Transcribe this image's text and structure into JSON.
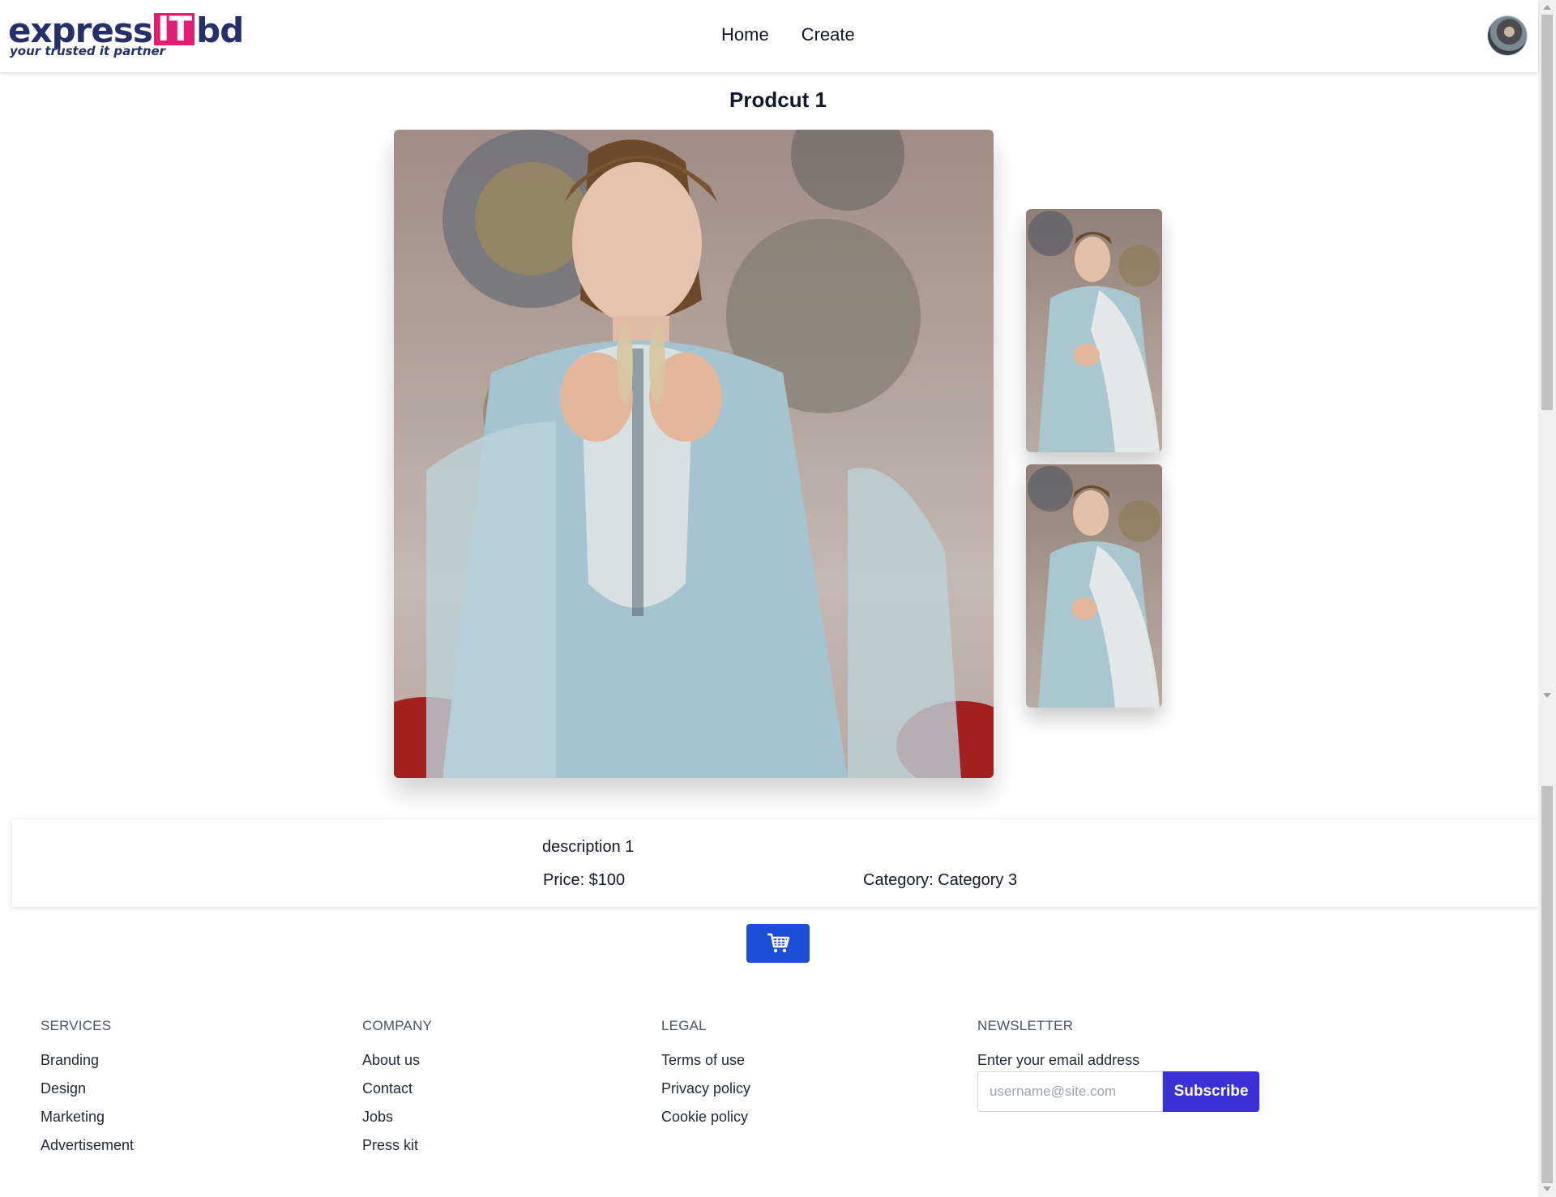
{
  "header": {
    "logo": {
      "brand_left": "express",
      "brand_highlight": "IT",
      "brand_right": "bd",
      "tagline": "your trusted it partner"
    },
    "nav": [
      {
        "label": "Home"
      },
      {
        "label": "Create"
      }
    ],
    "avatar_icon": "user-avatar"
  },
  "product": {
    "title": "Prodcut 1",
    "description": "description 1",
    "price_text": "Price: $100",
    "category_text": "Category: Category 3",
    "cart_icon": "shopping-cart-icon"
  },
  "footer": {
    "services": {
      "heading": "SERVICES",
      "links": [
        "Branding",
        "Design",
        "Marketing",
        "Advertisement"
      ]
    },
    "company": {
      "heading": "COMPANY",
      "links": [
        "About us",
        "Contact",
        "Jobs",
        "Press kit"
      ]
    },
    "legal": {
      "heading": "LEGAL",
      "links": [
        "Terms of use",
        "Privacy policy",
        "Cookie policy"
      ]
    },
    "newsletter": {
      "heading": "NEWSLETTER",
      "label": "Enter your email address",
      "placeholder": "username@site.com",
      "button": "Subscribe"
    }
  },
  "colors": {
    "brand_navy": "#25306b",
    "brand_pink": "#e11d74",
    "cart_button": "#1d4ed8",
    "subscribe_button": "#3b2fd6"
  }
}
